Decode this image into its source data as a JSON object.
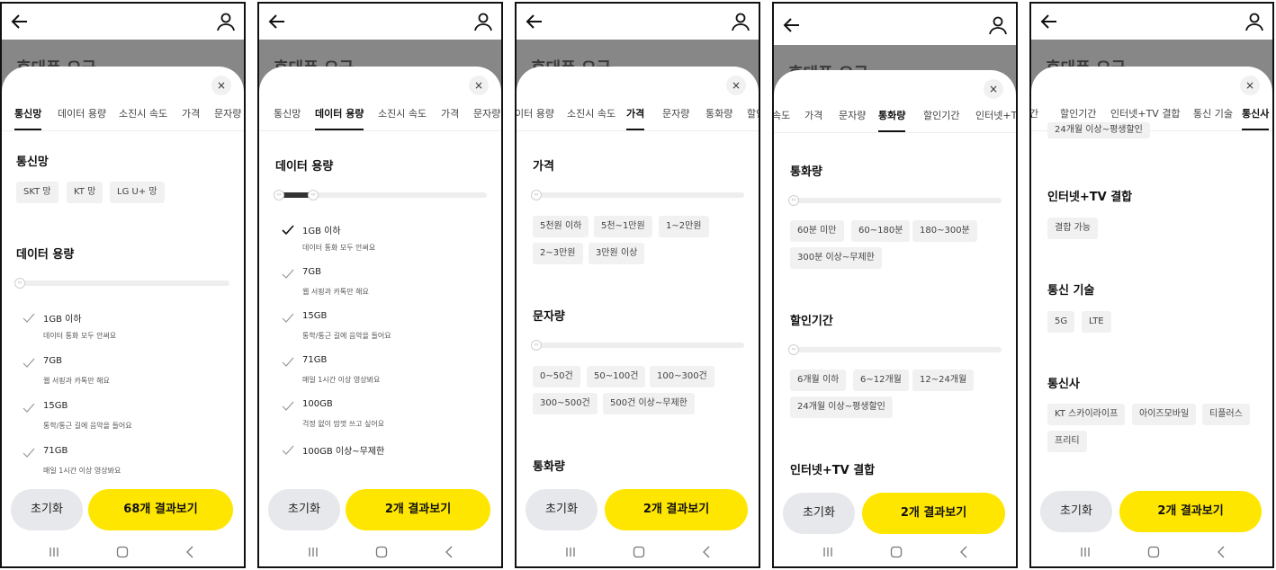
{
  "colors": {
    "accent_yellow": "#ffe600",
    "header_gray": "#878787",
    "chip_bg": "#f1f1f1",
    "reset_bg": "#e6e8eb"
  },
  "header": {
    "title": "휴대폰 요금"
  },
  "tabs": {
    "network": "통신망",
    "data": "데이터 용량",
    "speed": "소진시 속도",
    "price": "가격",
    "sms": "문자량",
    "voice": "통화량",
    "discount": "할인기간",
    "bundle": "인터넷+TV 결합",
    "tech": "통신 기술",
    "carrier": "통신사",
    "clip_data": "이터 용량",
    "clip_speed": "속도",
    "clip_bundle": "인터넷+TV",
    "clip_discount": "할인",
    "clip_period": "간"
  },
  "sections": {
    "network": "통신망",
    "data": "데이터 용량",
    "price": "가격",
    "sms": "문자량",
    "voice": "통화량",
    "discount": "할인기간",
    "bundle": "인터넷+TV 결합",
    "tech": "통신 기술",
    "carrier": "통신사"
  },
  "chips": {
    "network": [
      "SKT 망",
      "KT 망",
      "LG U+ 망"
    ],
    "price": [
      "5천원 이하",
      "5천~1만원",
      "1~2만원",
      "2~3만원",
      "3만원 이상"
    ],
    "sms": [
      "0~50건",
      "50~100건",
      "100~300건",
      "300~500건",
      "500건 이상~무제한"
    ],
    "voice": [
      "60분 미만",
      "60~180분",
      "180~300분",
      "300분 이상~무제한"
    ],
    "discount": [
      "6개월 이하",
      "6~12개월",
      "12~24개월",
      "24개월 이상~평생할인"
    ],
    "bundle": [
      "결합 가능"
    ],
    "tech": [
      "5G",
      "LTE"
    ],
    "carrier": [
      "KT 스카이라이프",
      "아이즈모바일",
      "티플러스",
      "프리티"
    ]
  },
  "data_options": [
    {
      "label": "1GB 이하",
      "desc": "데이터 통화 모두 안써요"
    },
    {
      "label": "7GB",
      "desc": "웹 서핑과 카톡만 해요"
    },
    {
      "label": "15GB",
      "desc": "통학/통근 길에 음악을 들어요"
    },
    {
      "label": "71GB",
      "desc": "매일 1시간 이상 영상봐요"
    },
    {
      "label": "100GB",
      "desc": "걱정 없이 맘껏 쓰고 싶어요"
    },
    {
      "label": "100GB 이상~무제한",
      "desc": ""
    }
  ],
  "data_selected_fraction": 0.2,
  "buttons": {
    "reset": "초기화",
    "results_1": "68개 결과보기",
    "results_2": "2개 결과보기"
  },
  "icons": {
    "close": "×",
    "back": "arrow-left-icon",
    "profile": "person-icon",
    "check": "check-icon"
  }
}
